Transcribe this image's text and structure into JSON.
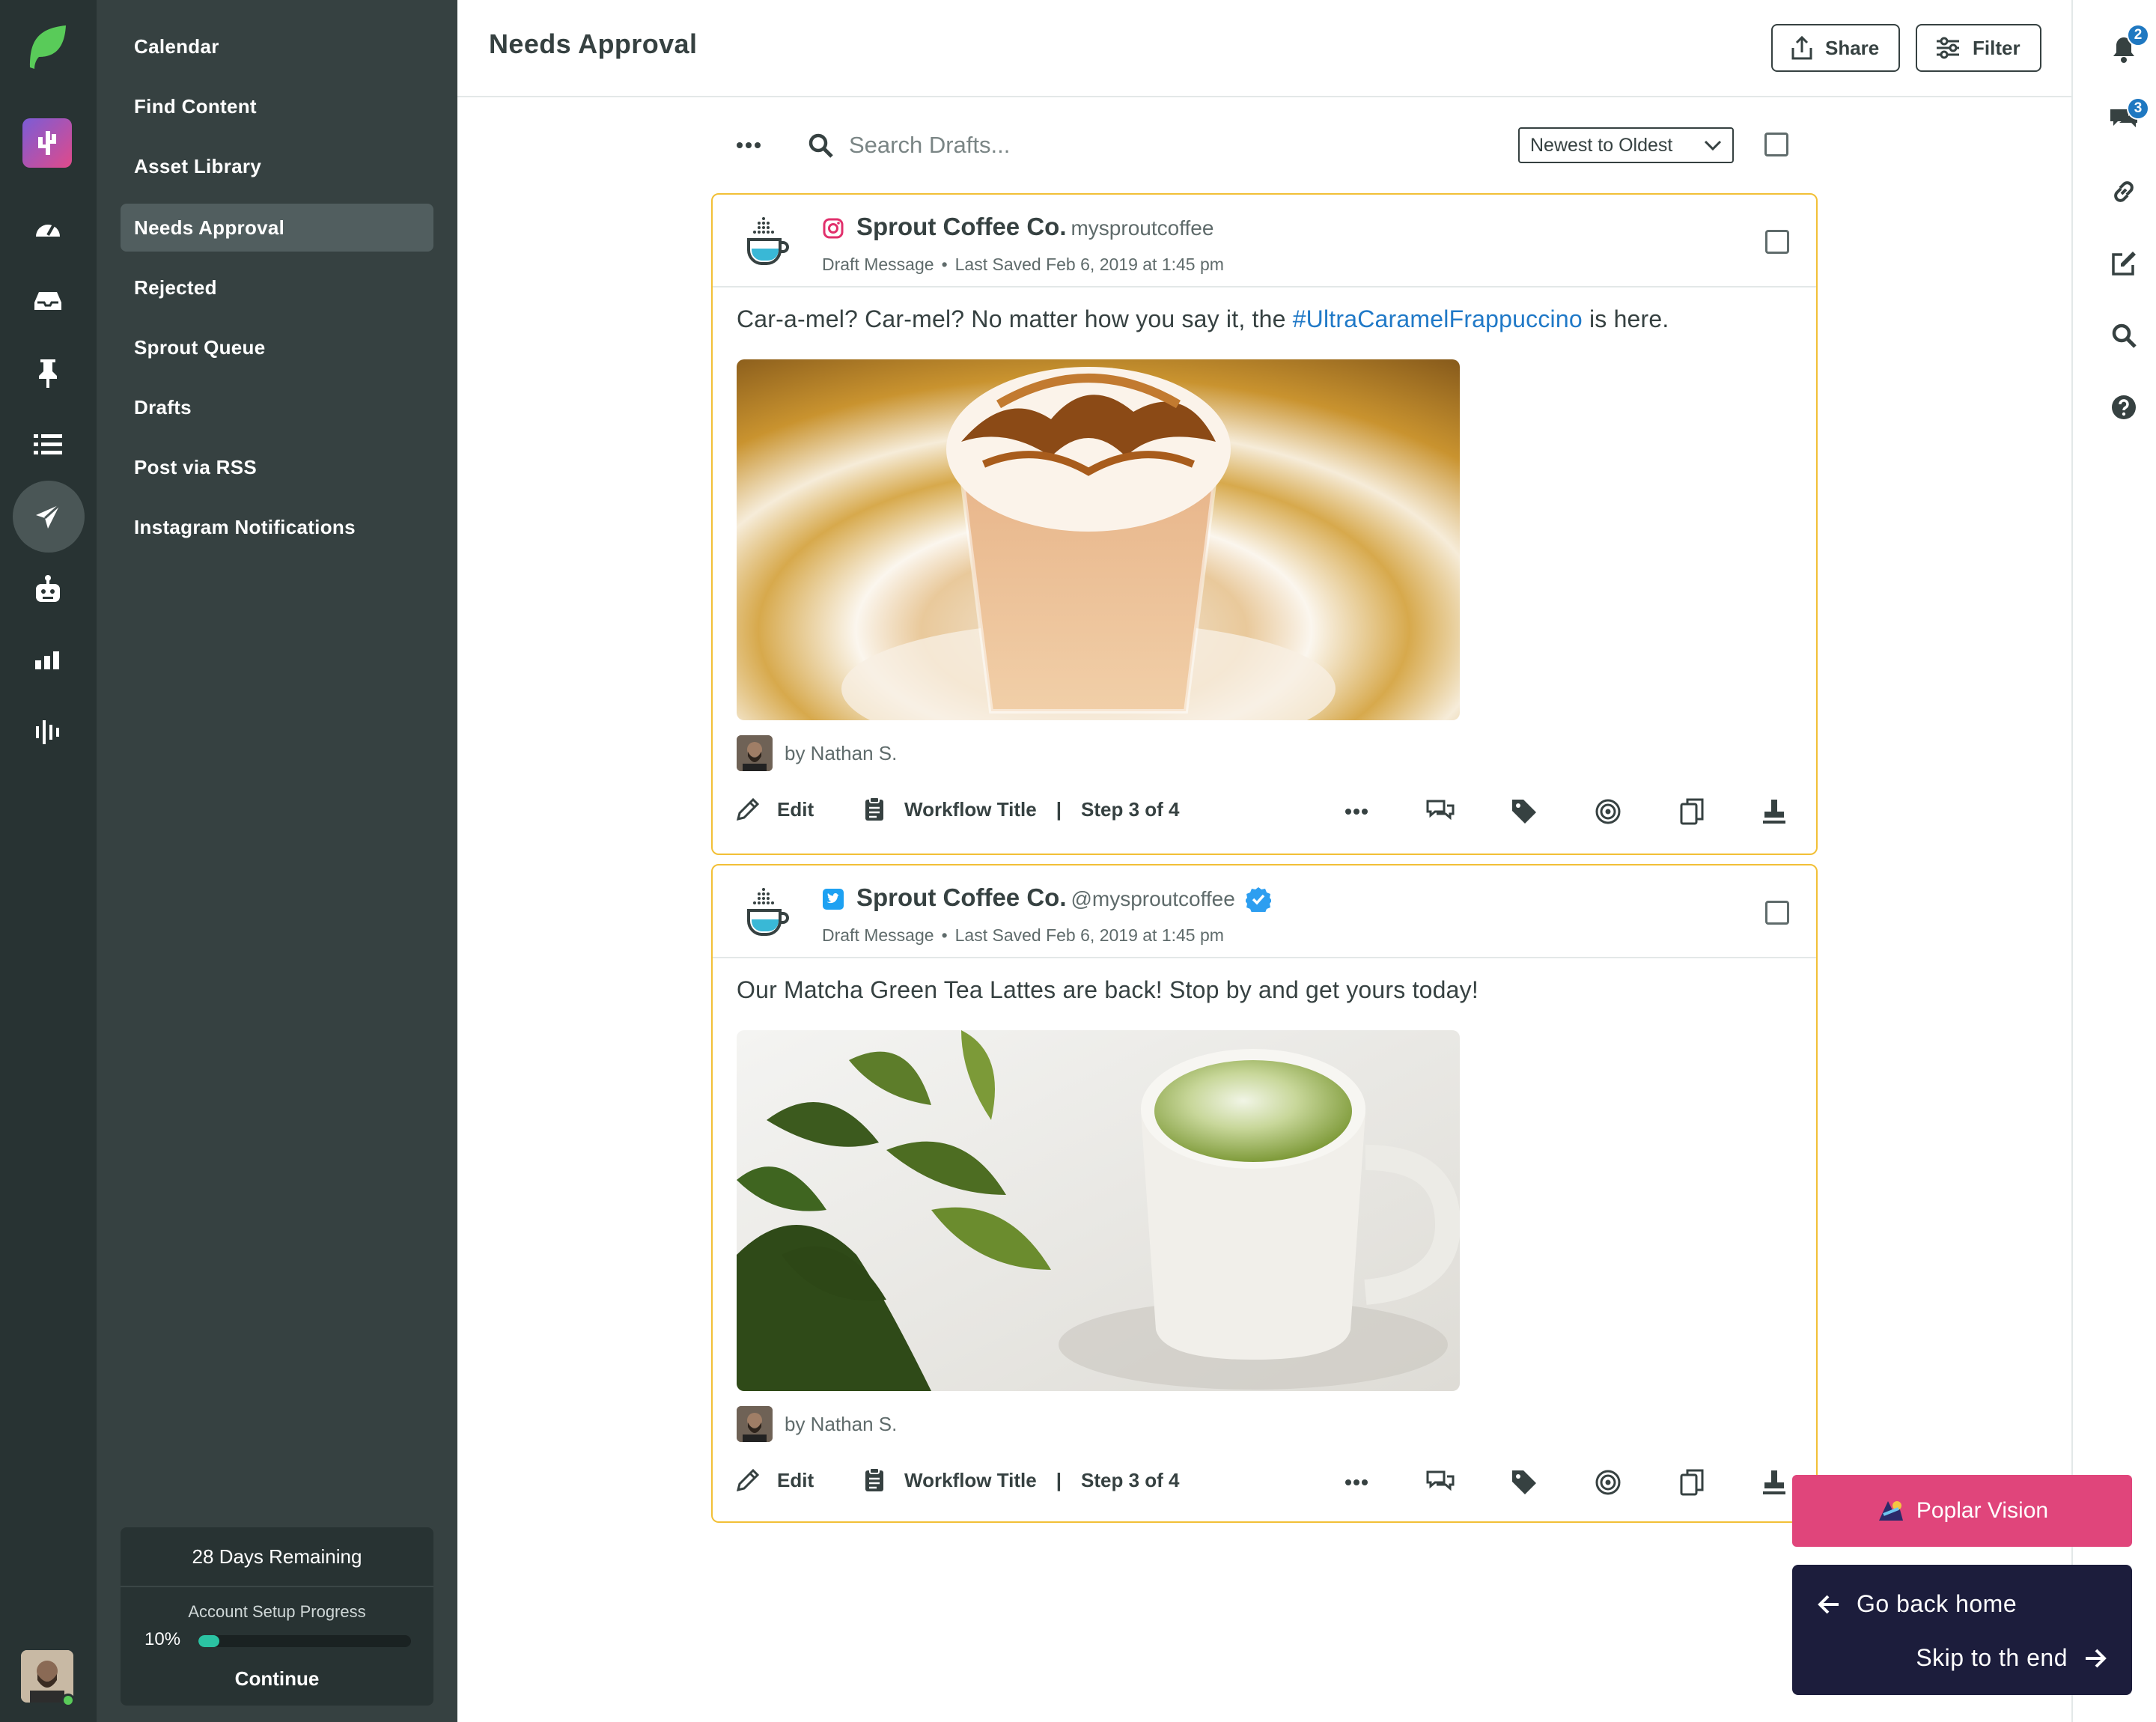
{
  "nav": {
    "items": [
      {
        "label": "Calendar",
        "active": false
      },
      {
        "label": "Find Content",
        "active": false
      },
      {
        "label": "Asset Library",
        "active": false
      },
      {
        "label": "Needs Approval",
        "active": true
      },
      {
        "label": "Rejected",
        "active": false
      },
      {
        "label": "Sprout Queue",
        "active": false
      },
      {
        "label": "Drafts",
        "active": false
      },
      {
        "label": "Post via RSS",
        "active": false
      },
      {
        "label": "Instagram Notifications",
        "active": false
      }
    ],
    "trial": {
      "days_remaining": "28 Days Remaining",
      "progress_label": "Account Setup Progress",
      "progress_text": "10%",
      "progress_value": 0.1,
      "continue_label": "Continue"
    }
  },
  "rail": {
    "icons": [
      "sprout-logo-icon",
      "app-switcher-icon",
      "dashboard-icon",
      "inbox-icon",
      "pin-icon",
      "list-icon",
      "publishing-icon",
      "bot-icon",
      "reports-icon",
      "listening-icon"
    ]
  },
  "header": {
    "title": "Needs Approval",
    "share_label": "Share",
    "filter_label": "Filter"
  },
  "right_bar": {
    "notifications_count": "2",
    "messages_count": "3"
  },
  "toolbar": {
    "search_placeholder": "Search Drafts...",
    "sort_value": "Newest to Oldest"
  },
  "cards": [
    {
      "network": "instagram",
      "name": "Sprout Coffee Co.",
      "handle": "mysproutcoffee",
      "verified": false,
      "type": "Draft Message",
      "saved": "Last Saved Feb 6, 2019 at 1:45 pm",
      "text_before": "Car-a-mel? Car-mel? No matter how you say it, the ",
      "hashtag": "#UltraCaramelFrappuccino",
      "text_after": " is here.",
      "author": "by Nathan S.",
      "edit_label": "Edit",
      "workflow_title": "Workflow Title",
      "workflow_step": "Step 3 of 4"
    },
    {
      "network": "twitter",
      "name": "Sprout Coffee Co.",
      "handle": "@mysproutcoffee",
      "verified": true,
      "type": "Draft Message",
      "saved": "Last Saved Feb 6, 2019 at 1:45 pm",
      "text_before": "Our Matcha Green Tea Lattes are back! Stop by and get yours today!",
      "hashtag": "",
      "text_after": "",
      "author": "by Nathan S.",
      "edit_label": "Edit",
      "workflow_title": "Workflow Title",
      "workflow_step": "Step 3 of 4"
    }
  ],
  "overlay": {
    "poplar_label": "Poplar Vision",
    "back_label": "Go back home",
    "skip_label": "Skip to th end"
  },
  "colors": {
    "rail_bg": "#283333",
    "nav_bg": "#364141",
    "card_border": "#f2c037",
    "hashtag": "#2079c7",
    "badge": "#1f78c1",
    "poplar": "#e0457b",
    "overlay": "#1c1d3c"
  }
}
